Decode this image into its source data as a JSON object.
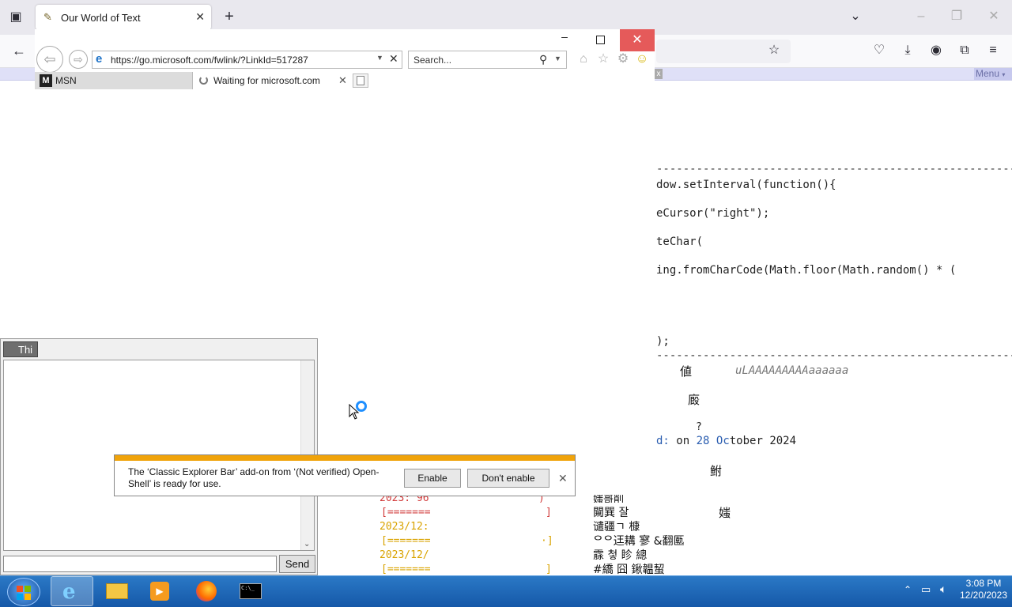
{
  "firefox": {
    "tab_title": "Our World of Text",
    "menu_label": "Menu",
    "page_code_lines": [
      "dow.setInterval(function(){",
      "eCursor(\"right\");",
      "teChar(",
      "ing.fromCharCode(Math.floor(Math.random() * (",
      ");"
    ],
    "dash_line": "------------------------------------------------------------",
    "art_chars": {
      "c1": "値",
      "c2": "uLAAAAAAAAAaaaaaa",
      "c3": "廄",
      "c4": "?",
      "c5": "鲋",
      "c6": "媸"
    },
    "date_text": {
      "prefix": "d: ",
      "on": "on ",
      "day": "28",
      "oc": "Oc",
      "rest": "tober 2024"
    },
    "log_lines": [
      "2023: 96",
      "[=======",
      "2023/12:",
      "[=======",
      "2023/12/",
      "[======="
    ],
    "log_brackets": [
      ")",
      "]",
      "·]",
      "]"
    ],
    "cjk_block": [
      "媸哥削",
      "闚巽 잘",
      "谴疆ㄱ   槺",
      "ᄋᄋ迋耩 寥 &翻匭",
      "霡 첳 眕       總",
      "#繑 囧 鍬韞蛪"
    ],
    "chat": {
      "tab_label": "Thi",
      "send_label": "Send"
    }
  },
  "ie": {
    "address": "https://go.microsoft.com/fwlink/?LinkId=517287",
    "search_placeholder": "Search...",
    "tabs": [
      {
        "label": "MSN"
      },
      {
        "label": "Waiting for microsoft.com"
      }
    ],
    "notification": {
      "message": "The ‘Classic Explorer Bar’ add-on from ‘(Not verified) Open-Shell’ is ready for use.",
      "enable_label": "Enable",
      "dont_enable_label": "Don't enable"
    }
  },
  "taskbar": {
    "time": "3:08 PM",
    "date": "12/20/2023"
  },
  "colors": {
    "notify_accent": "#f0a30a",
    "ie_close": "#e55a5a",
    "taskbar": "#1e66b6"
  }
}
